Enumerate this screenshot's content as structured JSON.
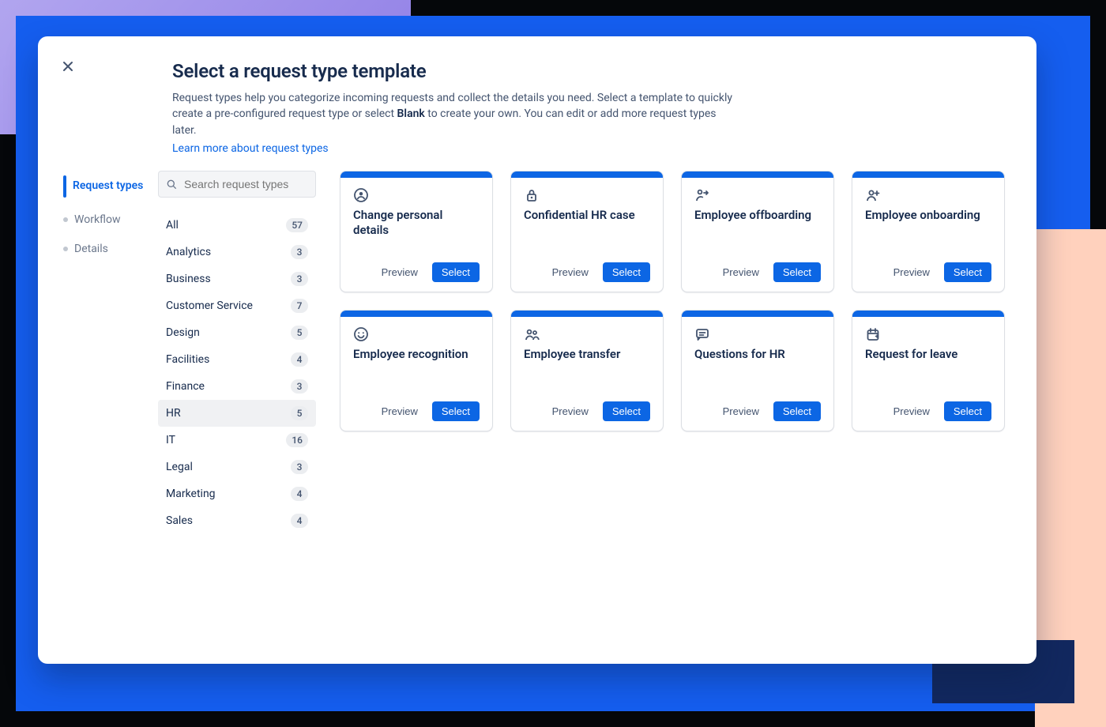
{
  "header": {
    "title": "Select a request type template",
    "desc_pre": "Request types help you categorize incoming requests and collect the details you need. Select a template to quickly create a pre-configured request type or select ",
    "desc_bold": "Blank",
    "desc_post": " to create your own. You can edit or add more request types later.",
    "learn_more": "Learn more about request types"
  },
  "tabs": [
    {
      "label": "Request types",
      "active": true
    },
    {
      "label": "Workflow",
      "active": false
    },
    {
      "label": "Details",
      "active": false
    }
  ],
  "search": {
    "placeholder": "Search request types"
  },
  "categories": [
    {
      "label": "All",
      "count": 57,
      "selected": false
    },
    {
      "label": "Analytics",
      "count": 3,
      "selected": false
    },
    {
      "label": "Business",
      "count": 3,
      "selected": false
    },
    {
      "label": "Customer Service",
      "count": 7,
      "selected": false
    },
    {
      "label": "Design",
      "count": 5,
      "selected": false
    },
    {
      "label": "Facilities",
      "count": 4,
      "selected": false
    },
    {
      "label": "Finance",
      "count": 3,
      "selected": false
    },
    {
      "label": "HR",
      "count": 5,
      "selected": true
    },
    {
      "label": "IT",
      "count": 16,
      "selected": false
    },
    {
      "label": "Legal",
      "count": 3,
      "selected": false
    },
    {
      "label": "Marketing",
      "count": 4,
      "selected": false
    },
    {
      "label": "Sales",
      "count": 4,
      "selected": false
    }
  ],
  "cards": [
    {
      "title": "Change personal details",
      "icon": "person-circle-icon"
    },
    {
      "title": "Confidential HR case",
      "icon": "lock-icon"
    },
    {
      "title": "Employee offboarding",
      "icon": "person-exit-icon"
    },
    {
      "title": "Employee onboarding",
      "icon": "person-add-icon"
    },
    {
      "title": "Employee recognition",
      "icon": "smile-icon"
    },
    {
      "title": "Employee transfer",
      "icon": "people-icon"
    },
    {
      "title": "Questions for HR",
      "icon": "chat-icon"
    },
    {
      "title": "Request for leave",
      "icon": "calendar-icon"
    }
  ],
  "buttons": {
    "preview": "Preview",
    "select": "Select"
  },
  "colors": {
    "accent": "#0C66E4"
  }
}
